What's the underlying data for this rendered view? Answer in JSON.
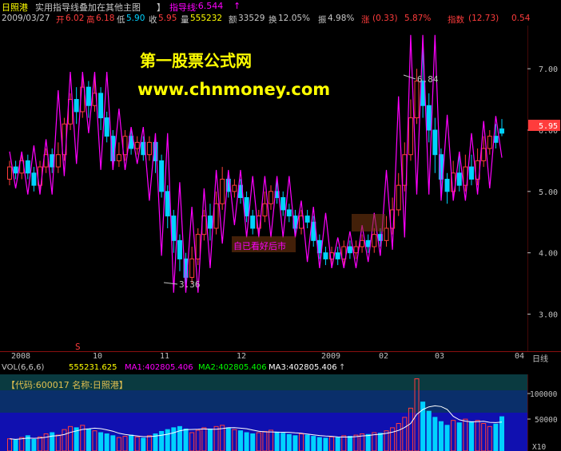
{
  "title_bar": {
    "stock_name": "日照港",
    "indicator_title": "实用指导线叠加在其他主图",
    "indicator_label": "指导线",
    "indicator_value": ":6.544",
    "up_arrow": "↑"
  },
  "info_bar": {
    "date": "2009/03/27",
    "open_label": "开",
    "open": "6.02",
    "high_label": "高",
    "high": "6.18",
    "low_label": "低",
    "low": "5.90",
    "close_label": "收",
    "close": "5.95",
    "volume_label": "量",
    "volume": "555232",
    "amount_label": "额",
    "amount": "33529",
    "turnover_label": "换",
    "turnover": "12.05%",
    "amplitude_label": "振",
    "amplitude": "4.98%",
    "change_label": "涨",
    "change": "(0.33)",
    "change_pct": "5.87%",
    "index_label": "指数",
    "index": "(12.73)",
    "index_tail": "0.54"
  },
  "watermark": {
    "line1": "第一股票公式网",
    "line2": "www.chnmoney.com"
  },
  "annotations": {
    "self_label": "自已看好后市",
    "low_mark": "3.36",
    "high_mark": "6.84",
    "s_mark": "S",
    "current_price": "5.95"
  },
  "price_axis": [
    "7.00",
    "6.00",
    "5.00",
    "4.00",
    "3.00"
  ],
  "date_axis": [
    "2008",
    "10",
    "11",
    "12",
    "2009",
    "02",
    "03",
    "04",
    "日线"
  ],
  "vol_bar": {
    "label": "VOL(6,6,6)",
    "vol": "555231.625",
    "ma1": "MA1:402805.406",
    "ma2": "MA2:402805.406",
    "ma3": "MA3:402805.406",
    "up_arrow": "↑"
  },
  "vol_panel": {
    "code_label": "【代码:600017 名称:日照港】"
  },
  "vol_axis": [
    "100000",
    "50000",
    "X10"
  ],
  "colors": {
    "up": "#ff3c3c",
    "down": "#00d2ff",
    "guide": "#ff00ff",
    "text": "#c0c0c0",
    "yellow": "#ffff00",
    "axis": "#8a1010",
    "vol_bg": "#1010b0"
  },
  "chart_data": {
    "type": "candlestick",
    "ylim": [
      2.5,
      7.6
    ],
    "price_ticks": [
      3,
      4,
      5,
      6,
      7
    ],
    "candles": [
      [
        5.2,
        5.4,
        5.1,
        5.5
      ],
      [
        5.4,
        5.3,
        5.2,
        5.5
      ],
      [
        5.3,
        5.5,
        5.2,
        5.6
      ],
      [
        5.5,
        5.3,
        5.2,
        5.6
      ],
      [
        5.3,
        5.1,
        5.0,
        5.4
      ],
      [
        5.1,
        5.4,
        5.0,
        5.5
      ],
      [
        5.4,
        5.6,
        5.3,
        5.7
      ],
      [
        5.6,
        5.4,
        5.3,
        5.7
      ],
      [
        5.4,
        5.6,
        5.3,
        5.8
      ],
      [
        5.6,
        6.1,
        5.5,
        6.2
      ],
      [
        6.1,
        6.5,
        6.0,
        6.6
      ],
      [
        6.5,
        6.3,
        6.1,
        6.7
      ],
      [
        6.3,
        6.7,
        6.2,
        6.9
      ],
      [
        6.7,
        6.4,
        6.2,
        6.8
      ],
      [
        6.4,
        6.6,
        6.3,
        6.9
      ],
      [
        6.6,
        6.2,
        6.0,
        6.7
      ],
      [
        6.2,
        5.9,
        5.8,
        6.3
      ],
      [
        5.9,
        5.5,
        5.4,
        6.0
      ],
      [
        5.5,
        5.6,
        5.4,
        5.8
      ],
      [
        5.6,
        5.9,
        5.5,
        6.0
      ],
      [
        5.9,
        5.7,
        5.6,
        6.0
      ],
      [
        5.7,
        5.8,
        5.6,
        5.9
      ],
      [
        5.8,
        5.6,
        5.5,
        5.9
      ],
      [
        5.6,
        5.8,
        5.5,
        5.9
      ],
      [
        5.8,
        5.5,
        5.3,
        5.9
      ],
      [
        5.5,
        5.0,
        4.9,
        5.6
      ],
      [
        5.0,
        4.6,
        4.4,
        5.1
      ],
      [
        4.6,
        4.2,
        4.0,
        4.7
      ],
      [
        4.2,
        3.9,
        3.7,
        4.3
      ],
      [
        3.9,
        3.6,
        3.4,
        4.0
      ],
      [
        3.6,
        3.9,
        3.5,
        4.1
      ],
      [
        3.9,
        4.3,
        3.8,
        4.4
      ],
      [
        4.3,
        4.6,
        4.2,
        4.7
      ],
      [
        4.6,
        4.4,
        4.2,
        4.8
      ],
      [
        4.4,
        4.8,
        4.3,
        5.0
      ],
      [
        4.8,
        5.2,
        4.7,
        5.4
      ],
      [
        5.2,
        5.0,
        4.9,
        5.3
      ],
      [
        5.0,
        5.1,
        4.9,
        5.2
      ],
      [
        5.1,
        4.9,
        4.8,
        5.2
      ],
      [
        4.9,
        4.6,
        4.5,
        5.0
      ],
      [
        4.6,
        4.4,
        4.3,
        4.7
      ],
      [
        4.4,
        4.6,
        4.3,
        4.7
      ],
      [
        4.6,
        4.8,
        4.5,
        5.0
      ],
      [
        4.8,
        5.0,
        4.7,
        5.1
      ],
      [
        5.0,
        4.9,
        4.8,
        5.2
      ],
      [
        4.9,
        4.7,
        4.6,
        5.0
      ],
      [
        4.7,
        4.6,
        4.5,
        4.8
      ],
      [
        4.6,
        4.4,
        4.3,
        4.7
      ],
      [
        4.4,
        4.6,
        4.3,
        4.7
      ],
      [
        4.6,
        4.5,
        4.4,
        4.7
      ],
      [
        4.5,
        4.2,
        4.1,
        4.6
      ],
      [
        4.2,
        4.0,
        3.9,
        4.3
      ],
      [
        4.0,
        3.9,
        3.8,
        4.1
      ],
      [
        3.9,
        4.0,
        3.8,
        4.1
      ],
      [
        4.0,
        3.9,
        3.8,
        4.1
      ],
      [
        3.9,
        4.1,
        3.8,
        4.2
      ],
      [
        4.1,
        4.0,
        3.9,
        4.2
      ],
      [
        4.0,
        4.1,
        3.9,
        4.2
      ],
      [
        4.1,
        4.2,
        4.0,
        4.3
      ],
      [
        4.2,
        4.1,
        4.0,
        4.3
      ],
      [
        4.1,
        4.3,
        4.0,
        4.4
      ],
      [
        4.3,
        4.2,
        4.1,
        4.4
      ],
      [
        4.2,
        4.4,
        4.1,
        4.6
      ],
      [
        4.4,
        4.7,
        4.3,
        4.9
      ],
      [
        4.7,
        5.1,
        4.6,
        5.3
      ],
      [
        5.1,
        5.6,
        5.0,
        5.8
      ],
      [
        5.6,
        6.2,
        5.5,
        6.5
      ],
      [
        6.2,
        6.8,
        6.1,
        7.0
      ],
      [
        6.8,
        6.4,
        6.2,
        7.5
      ],
      [
        6.4,
        6.0,
        5.8,
        6.6
      ],
      [
        6.0,
        5.6,
        5.3,
        6.2
      ],
      [
        5.6,
        5.2,
        5.0,
        5.7
      ],
      [
        5.2,
        5.0,
        4.8,
        5.3
      ],
      [
        5.0,
        5.3,
        4.9,
        5.5
      ],
      [
        5.3,
        5.1,
        5.0,
        5.6
      ],
      [
        5.1,
        5.4,
        5.0,
        5.6
      ],
      [
        5.4,
        5.2,
        5.1,
        5.6
      ],
      [
        5.2,
        5.5,
        5.1,
        5.7
      ],
      [
        5.5,
        5.7,
        5.4,
        5.9
      ],
      [
        5.7,
        5.9,
        5.6,
        6.0
      ],
      [
        5.9,
        5.8,
        5.7,
        6.1
      ],
      [
        6.02,
        5.95,
        5.9,
        6.18
      ]
    ],
    "volumes": [
      20,
      18,
      22,
      25,
      19,
      23,
      28,
      30,
      26,
      35,
      40,
      38,
      42,
      36,
      33,
      30,
      28,
      25,
      22,
      24,
      26,
      23,
      21,
      25,
      28,
      32,
      35,
      38,
      40,
      36,
      30,
      34,
      38,
      36,
      40,
      42,
      38,
      35,
      33,
      30,
      28,
      30,
      32,
      34,
      31,
      29,
      27,
      25,
      28,
      26,
      24,
      22,
      21,
      23,
      22,
      25,
      24,
      26,
      28,
      27,
      30,
      29,
      33,
      38,
      45,
      55,
      70,
      118,
      80,
      65,
      55,
      48,
      42,
      50,
      46,
      52,
      48,
      50,
      45,
      40,
      44,
      56
    ]
  }
}
